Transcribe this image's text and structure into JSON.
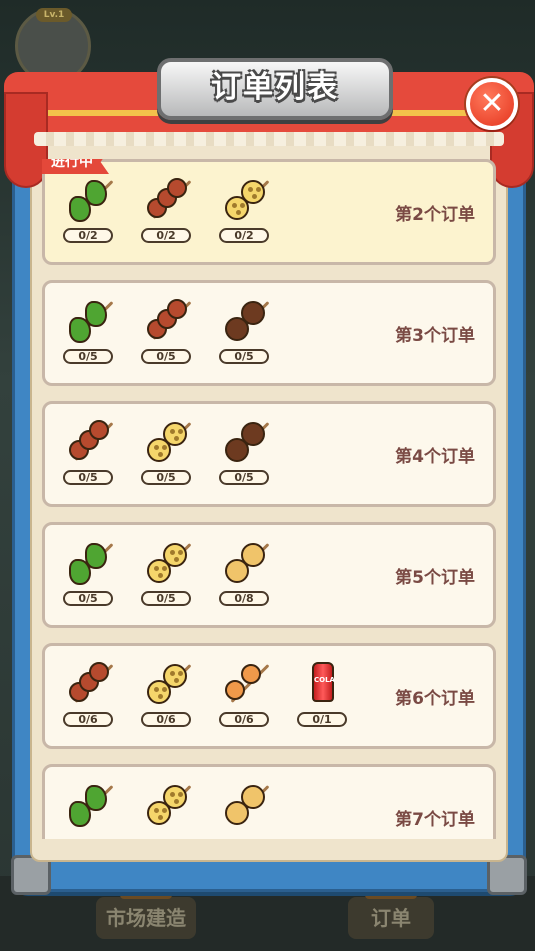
{
  "background": {
    "level_badge": "Lv.1",
    "bottom_buttons": [
      {
        "label": "市场建造"
      },
      {
        "label": "订单"
      }
    ]
  },
  "dialog": {
    "title": "订单列表",
    "close_icon": "close-x-icon",
    "accent_color": "#e4483a",
    "frame_color": "#3f86c4"
  },
  "orders": [
    {
      "label": "第2个订单",
      "status": "进行中",
      "active": true,
      "items": [
        {
          "food": "green-pepper-skewer-icon",
          "count": "0/2"
        },
        {
          "food": "meat-skewer-icon",
          "count": "0/2"
        },
        {
          "food": "lotus-root-skewer-icon",
          "count": "0/2"
        }
      ]
    },
    {
      "label": "第3个订单",
      "items": [
        {
          "food": "green-pepper-skewer-icon",
          "count": "0/5"
        },
        {
          "food": "meat-skewer-icon",
          "count": "0/5"
        },
        {
          "food": "mushroom-skewer-icon",
          "count": "0/5"
        }
      ]
    },
    {
      "label": "第4个订单",
      "items": [
        {
          "food": "meat-skewer-icon",
          "count": "0/5"
        },
        {
          "food": "lotus-root-skewer-icon",
          "count": "0/5"
        },
        {
          "food": "mushroom-skewer-icon",
          "count": "0/5"
        }
      ]
    },
    {
      "label": "第5个订单",
      "items": [
        {
          "food": "green-pepper-skewer-icon",
          "count": "0/5"
        },
        {
          "food": "lotus-root-skewer-icon",
          "count": "0/5"
        },
        {
          "food": "potato-skewer-icon",
          "count": "0/8"
        }
      ]
    },
    {
      "label": "第6个订单",
      "items": [
        {
          "food": "meat-skewer-icon",
          "count": "0/6"
        },
        {
          "food": "lotus-root-skewer-icon",
          "count": "0/6"
        },
        {
          "food": "fishball-skewer-icon",
          "count": "0/6"
        },
        {
          "food": "soda-can-icon",
          "count": "0/1"
        }
      ]
    },
    {
      "label": "第7个订单",
      "items": [
        {
          "food": "green-pepper-skewer-icon",
          "count": ""
        },
        {
          "food": "lotus-root-skewer-icon",
          "count": ""
        },
        {
          "food": "potato-skewer-icon",
          "count": ""
        }
      ]
    }
  ]
}
